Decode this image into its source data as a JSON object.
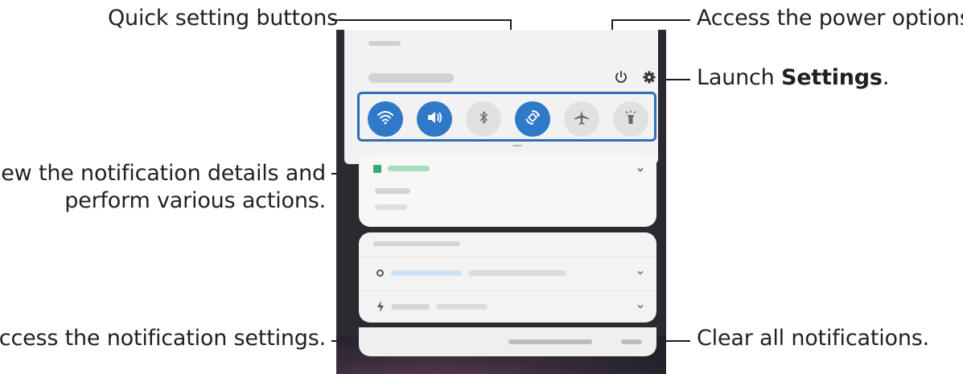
{
  "callouts": {
    "quick_settings": "Quick setting buttons",
    "power_options": "Access the power options.",
    "launch_prefix": "Launch ",
    "launch_settings_bold": "Settings",
    "launch_suffix": ".",
    "notification_details_line1": "View the notification details and",
    "notification_details_line2": "perform various actions.",
    "notification_settings": "Access the notification settings.",
    "clear_all": "Clear all notifications."
  },
  "panel": {
    "quick_settings": [
      {
        "name": "wifi",
        "icon": "wifi-icon",
        "state": "on"
      },
      {
        "name": "sound",
        "icon": "speaker-icon",
        "state": "on"
      },
      {
        "name": "bluetooth",
        "icon": "bluetooth-icon",
        "state": "off"
      },
      {
        "name": "auto-rotate",
        "icon": "rotate-icon",
        "state": "on"
      },
      {
        "name": "airplane-mode",
        "icon": "airplane-icon",
        "state": "off"
      },
      {
        "name": "flashlight",
        "icon": "flashlight-icon",
        "state": "off"
      }
    ],
    "header_icons": [
      "power-icon",
      "gear-icon"
    ]
  },
  "colors": {
    "accent_blue": "#2f79c9",
    "highlight_border": "#2f6fb5",
    "calendar_green": "#3aa874"
  }
}
